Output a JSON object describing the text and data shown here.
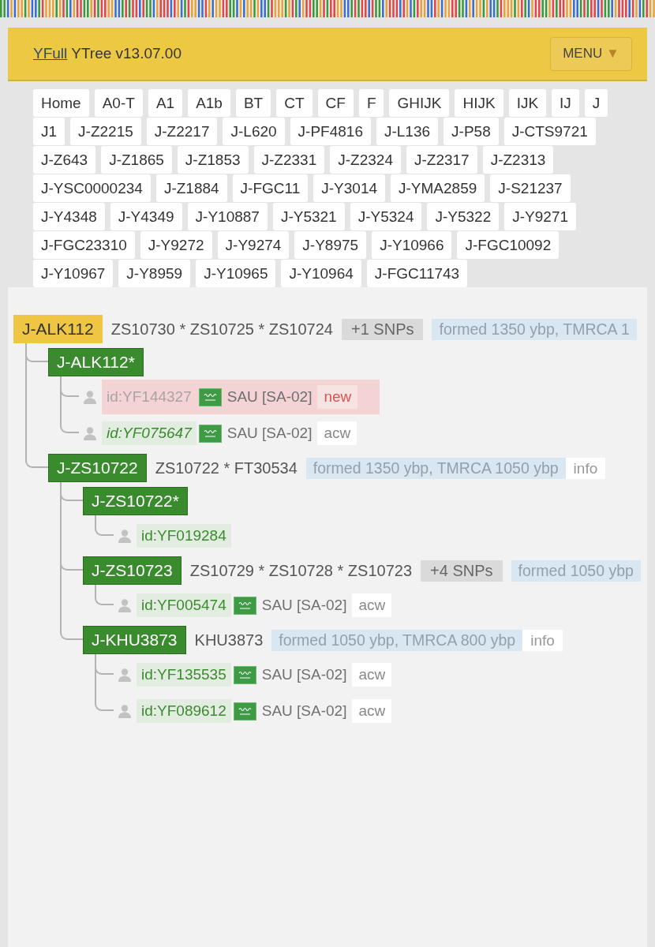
{
  "header": {
    "link": "YFull",
    "title": "YTree v13.07.00",
    "menu": {
      "label": "MENU",
      "caret": "▼"
    }
  },
  "breadcrumbs": [
    "Home",
    "A0-T",
    "A1",
    "A1b",
    "BT",
    "CT",
    "CF",
    "F",
    "GHIJK",
    "HIJK",
    "IJK",
    "IJ",
    "J",
    "J1",
    "J-Z2215",
    "J-Z2217",
    "J-L620",
    "J-PF4816",
    "J-L136",
    "J-P58",
    "J-CTS9721",
    "J-Z643",
    "J-Z1865",
    "J-Z1853",
    "J-Z2331",
    "J-Z2324",
    "J-Z2317",
    "J-Z2313",
    "J-YSC0000234",
    "J-Z1884",
    "J-FGC11",
    "J-Y3014",
    "J-YMA2859",
    "J-S21237",
    "J-Y4348",
    "J-Y4349",
    "J-Y10887",
    "J-Y5321",
    "J-Y5324",
    "J-Y5322",
    "J-Y9271",
    "J-FGC23310",
    "J-Y9272",
    "J-Y9274",
    "J-Y8975",
    "J-Y10966",
    "J-FGC10092",
    "J-Y10967",
    "J-Y8959",
    "J-Y10965",
    "J-Y10964",
    "J-FGC11743"
  ],
  "tree": {
    "kind": "clade",
    "name": "J-ALK112",
    "current": true,
    "snps": "ZS10730 * ZS10725 * ZS10724",
    "more_snps": "+1 SNPs",
    "age": "formed 1350 ybp, TMRCA 1",
    "children": [
      {
        "kind": "clade",
        "name": "J-ALK112*",
        "current": false,
        "children": [
          {
            "kind": "sample",
            "id": "id:YF144327",
            "new": true,
            "marked": false,
            "flag": true,
            "country": "SAU [SA-02]",
            "tag": "new"
          },
          {
            "kind": "sample",
            "id": "id:YF075647",
            "new": false,
            "marked": true,
            "flag": true,
            "country": "SAU [SA-02]",
            "tag": "acw"
          }
        ]
      },
      {
        "kind": "clade",
        "name": "J-ZS10722",
        "current": false,
        "snps": "ZS10722 * FT30534",
        "age": "formed 1350 ybp, TMRCA 1050 ybp",
        "info": "info",
        "children": [
          {
            "kind": "clade",
            "name": "J-ZS10722*",
            "current": false,
            "children": [
              {
                "kind": "sample",
                "id": "id:YF019284",
                "new": false,
                "marked": false,
                "flag": false
              }
            ]
          },
          {
            "kind": "clade",
            "name": "J-ZS10723",
            "current": false,
            "snps": "ZS10729 * ZS10728 * ZS10723",
            "more_snps": "+4 SNPs",
            "age": "formed 1050 ybp",
            "children": [
              {
                "kind": "sample",
                "id": "id:YF005474",
                "new": false,
                "marked": false,
                "flag": true,
                "country": "SAU [SA-02]",
                "tag": "acw"
              }
            ]
          },
          {
            "kind": "clade",
            "name": "J-KHU3873",
            "current": false,
            "snps": "KHU3873",
            "age": "formed 1050 ybp, TMRCA 800 ybp",
            "info": "info",
            "children": [
              {
                "kind": "sample",
                "id": "id:YF135535",
                "new": false,
                "marked": false,
                "flag": true,
                "country": "SAU [SA-02]",
                "tag": "acw"
              },
              {
                "kind": "sample",
                "id": "id:YF089612",
                "new": false,
                "marked": false,
                "flag": true,
                "country": "SAU [SA-02]",
                "tag": "acw"
              }
            ]
          }
        ]
      }
    ]
  }
}
